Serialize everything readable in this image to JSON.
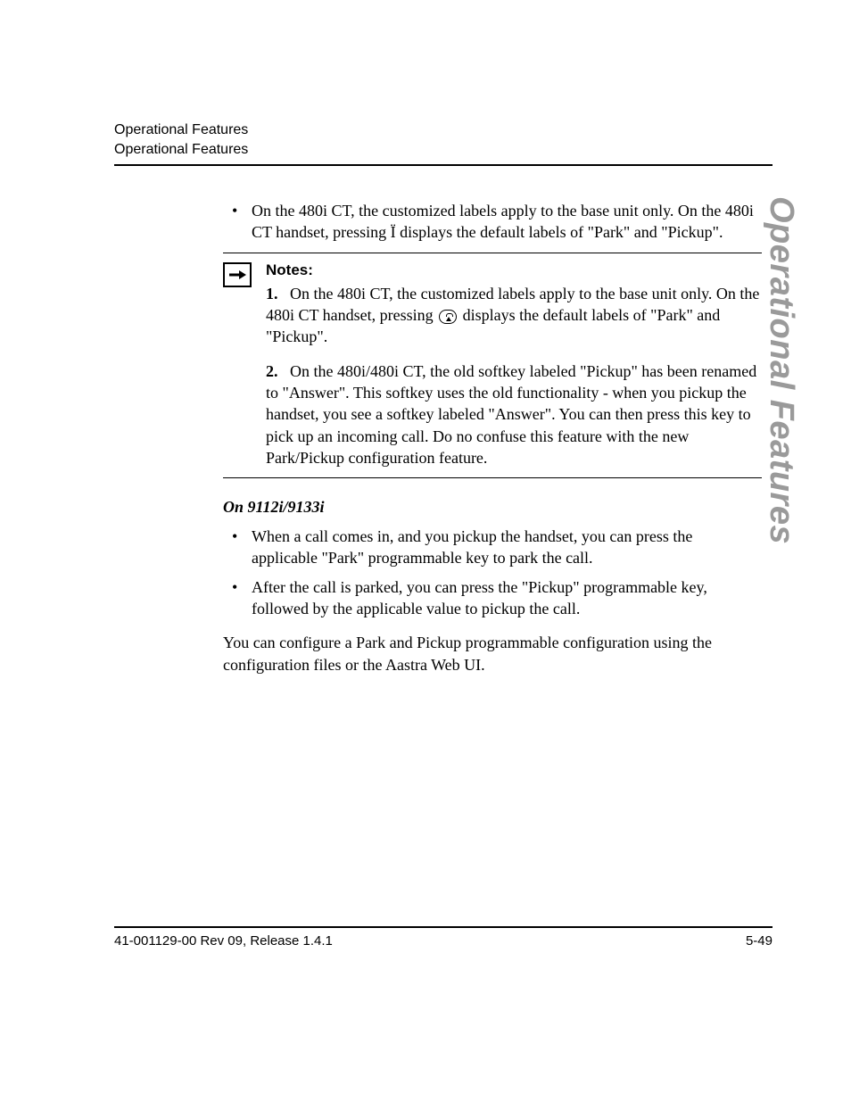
{
  "header": {
    "line1": "Operational Features",
    "line2": "Operational Features"
  },
  "side_tab": "Operational Features",
  "top_bullets": [
    "On the 480i CT, the customized labels apply to the base unit only. On the 480i CT handset, pressing Ï displays the default labels of \"Park\" and \"Pickup\"."
  ],
  "notes": {
    "heading": "Notes:",
    "items": [
      {
        "num": "1.",
        "before_icon": "On the 480i CT, the customized labels apply to the base unit only. On the 480i CT handset, pressing ",
        "after_icon": " displays the default labels of \"Park\" and \"Pickup\"."
      },
      {
        "num": "2.",
        "text": "On the 480i/480i CT, the old softkey labeled \"Pickup\" has been renamed to \"Answer\".  This softkey uses the old functionality - when you pickup the handset, you see a softkey labeled \"Answer\".  You can then press this key to pick up an incoming call.  Do no confuse this feature with the new Park/Pickup configuration feature."
      }
    ]
  },
  "subhead": "On 9112i/9133i",
  "sub_bullets": [
    "When a call comes in, and you pickup the handset, you can press the applicable \"Park\" programmable key to park the call.",
    "After the call is parked, you can press the \"Pickup\" programmable key, followed by the applicable value to pickup the call."
  ],
  "closing_para": "You can configure a Park and Pickup programmable configuration using the configuration files or the Aastra Web UI.",
  "footer": {
    "left": "41-001129-00 Rev 09, Release 1.4.1",
    "right": "5-49"
  }
}
